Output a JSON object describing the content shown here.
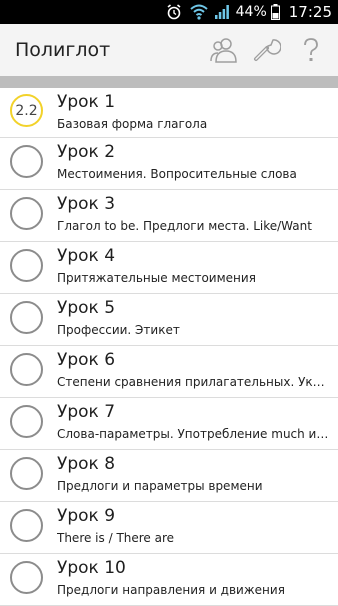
{
  "status_bar": {
    "battery": "44%",
    "time": "17:25",
    "icons": [
      "alarm-icon",
      "wifi-icon",
      "signal-icon",
      "battery-icon"
    ]
  },
  "app_bar": {
    "title": "Полиглот",
    "actions": [
      "users-icon",
      "wrench-icon",
      "help-icon"
    ]
  },
  "colors": {
    "active_ring": "#f2d22a",
    "ring": "#8c8c8c",
    "app_bar_bg": "#f4f4f4"
  },
  "lessons": [
    {
      "title": "Урок 1",
      "subtitle": "Базовая форма глагола",
      "badge": "2.2"
    },
    {
      "title": "Урок 2",
      "subtitle": "Местоимения. Вопросительные слова",
      "badge": ""
    },
    {
      "title": "Урок 3",
      "subtitle": "Глагол to be. Предлоги места. Like/Want",
      "badge": ""
    },
    {
      "title": "Урок 4",
      "subtitle": "Притяжательные местоимения",
      "badge": ""
    },
    {
      "title": "Урок 5",
      "subtitle": "Профессии. Этикет",
      "badge": ""
    },
    {
      "title": "Урок 6",
      "subtitle": "Степени сравнения прилагательных. Указательные местоимения",
      "badge": ""
    },
    {
      "title": "Урок 7",
      "subtitle": "Слова-параметры. Употребление much и many",
      "badge": ""
    },
    {
      "title": "Урок 8",
      "subtitle": "Предлоги и параметры времени",
      "badge": ""
    },
    {
      "title": "Урок 9",
      "subtitle": "There is / There are",
      "badge": ""
    },
    {
      "title": "Урок 10",
      "subtitle": "Предлоги направления и движения",
      "badge": ""
    }
  ]
}
